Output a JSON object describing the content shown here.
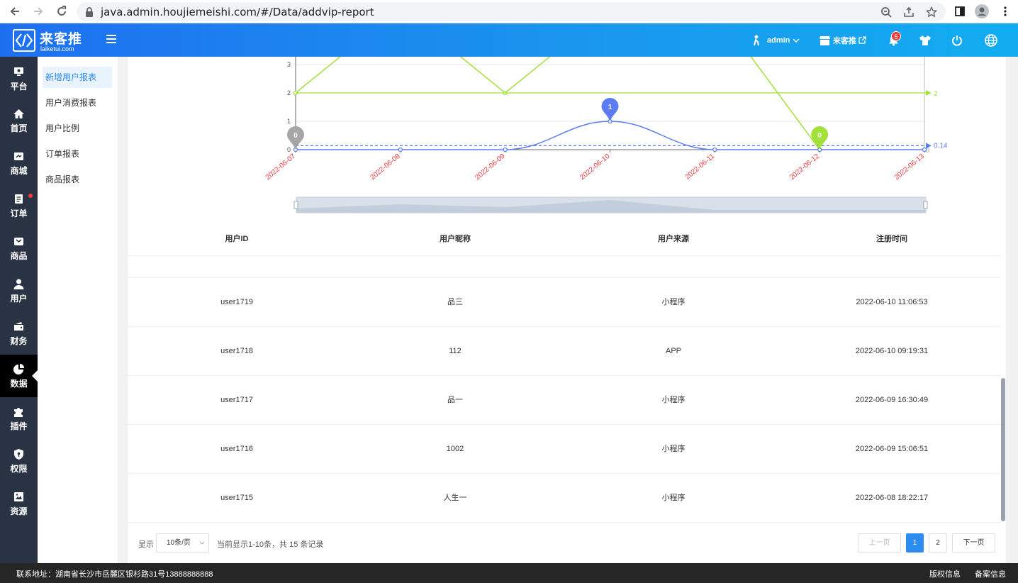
{
  "browser": {
    "url": "java.admin.houjiemeishi.com/#/Data/addvip-report"
  },
  "header": {
    "logo_cn": "来客推",
    "logo_en": "laiketui.com",
    "user": "admin",
    "store": "来客推",
    "notification_count": "5"
  },
  "sidebar": {
    "items": [
      {
        "label": "平台",
        "icon": "platform-icon"
      },
      {
        "label": "首页",
        "icon": "home-icon"
      },
      {
        "label": "商城",
        "icon": "mall-icon"
      },
      {
        "label": "订单",
        "icon": "order-icon"
      },
      {
        "label": "商品",
        "icon": "goods-icon"
      },
      {
        "label": "用户",
        "icon": "user-icon"
      },
      {
        "label": "财务",
        "icon": "wallet-icon"
      },
      {
        "label": "数据",
        "icon": "pie-chart-icon"
      },
      {
        "label": "插件",
        "icon": "puzzle-icon"
      },
      {
        "label": "权限",
        "icon": "shield-icon"
      },
      {
        "label": "资源",
        "icon": "image-icon"
      }
    ],
    "active": "数据"
  },
  "submenu": {
    "items": [
      "新增用户报表",
      "用户消费报表",
      "用户比例",
      "订单报表",
      "商品报表"
    ],
    "active": "新增用户报表"
  },
  "chart_data": {
    "type": "line",
    "x": [
      "2022-06-07",
      "2022-06-08",
      "2022-06-09",
      "2022-06-10",
      "2022-06-11",
      "2022-06-12",
      "2022-06-13"
    ],
    "y_ticks": [
      "0",
      "1",
      "2",
      "3"
    ],
    "series": [
      {
        "values": [
          2,
          5,
          2,
          5,
          5,
          0,
          null
        ],
        "color": "#a3e03a",
        "mark_line": "2",
        "mark_point": "0"
      },
      {
        "values": [
          0,
          0,
          0,
          1,
          0,
          0,
          0
        ],
        "color": "#5b7cf2",
        "mark_line": "0.14",
        "mark_point_max": "1",
        "mark_point_min": "0"
      }
    ],
    "right_axis_label": "0",
    "ylim": [
      0,
      3
    ]
  },
  "table": {
    "headers": [
      "用户ID",
      "用户昵称",
      "用户来源",
      "注册时间"
    ],
    "rows": [
      [
        "user1719",
        "品三",
        "小程序",
        "2022-06-10 11:06:53"
      ],
      [
        "user1718",
        "112",
        "APP",
        "2022-06-10 09:19:31"
      ],
      [
        "user1717",
        "品一",
        "小程序",
        "2022-06-09 16:30:49"
      ],
      [
        "user1716",
        "1002",
        "小程序",
        "2022-06-09 15:06:51"
      ],
      [
        "user1715",
        "人生一",
        "小程序",
        "2022-06-08 18:22:17"
      ]
    ]
  },
  "pager": {
    "show_label": "显示",
    "page_size": "10条/页",
    "summary": "当前显示1-10条，共 15 条记录",
    "prev": "上一页",
    "pages": [
      "1",
      "2"
    ],
    "current": "1",
    "next": "下一页"
  },
  "footer": {
    "address": "联系地址：湖南省长沙市岳麓区银杉路31号13888888888",
    "copyright": "版权信息",
    "record": "备案信息"
  }
}
